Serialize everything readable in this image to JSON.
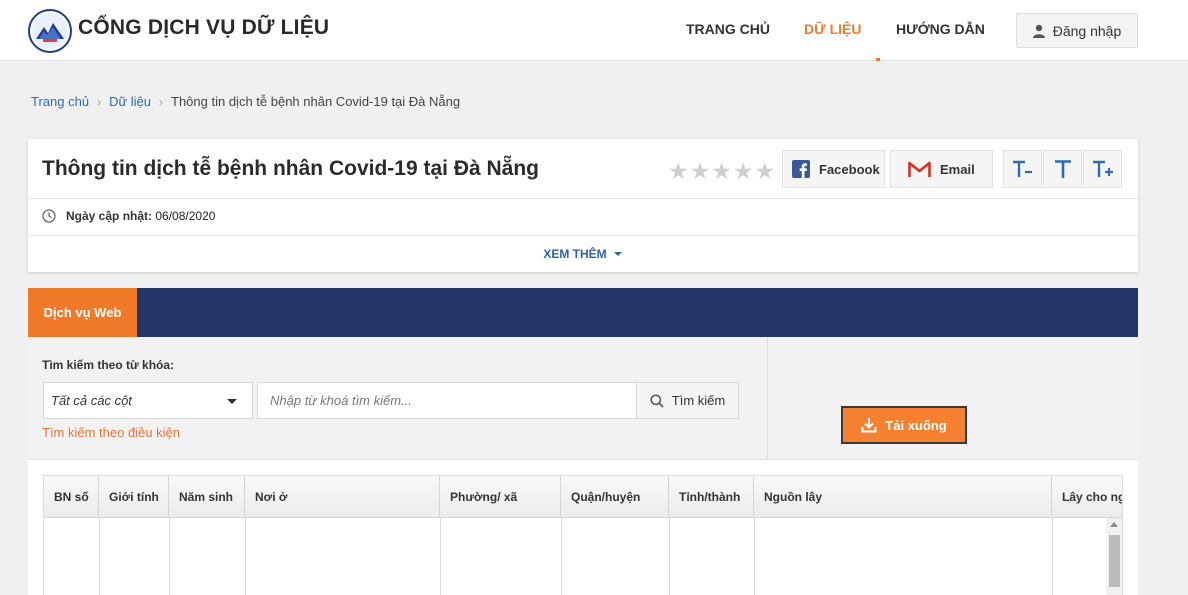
{
  "header": {
    "brand": "CỔNG DỊCH VỤ DỮ LIỆU",
    "nav": [
      {
        "label": "TRANG CHỦ",
        "active": false
      },
      {
        "label": "DỮ LIỆU",
        "active": true
      },
      {
        "label": "HƯỚNG DẪN",
        "active": false
      }
    ],
    "login_label": "Đăng nhập"
  },
  "breadcrumb": {
    "items": [
      "Trang chủ",
      "Dữ liệu"
    ],
    "current": "Thông tin dịch tễ bệnh nhân Covid-19 tại Đà Nẵng"
  },
  "dataset": {
    "title": "Thông tin dịch tễ bệnh nhân Covid-19 tại Đà Nẵng",
    "rating": 0,
    "rating_max": 5,
    "share": {
      "facebook": "Facebook",
      "email": "Email"
    },
    "updated_label": "Ngày cập nhật:",
    "updated_value": "06/08/2020",
    "more_label": "XEM THÊM"
  },
  "service": {
    "tab_label": "Dịch vụ Web",
    "search_label": "Tìm kiếm theo từ khóa:",
    "column_select_value": "Tất cả các cột",
    "keyword_placeholder": "Nhập từ khoá tìm kiếm...",
    "search_button": "Tìm kiếm",
    "condition_link": "Tìm kiếm theo điều kiện",
    "download_button": "Tải xuống"
  },
  "table": {
    "columns": [
      "BN số",
      "Giới tính",
      "Năm sinh",
      "Nơi ở",
      "Phường/ xã",
      "Quận/huyện",
      "Tỉnh/thành",
      "Nguồn lây",
      "Lây cho ng"
    ]
  },
  "colors": {
    "accent": "#f07a28",
    "navy": "#243567",
    "link": "#2d6bb5"
  }
}
